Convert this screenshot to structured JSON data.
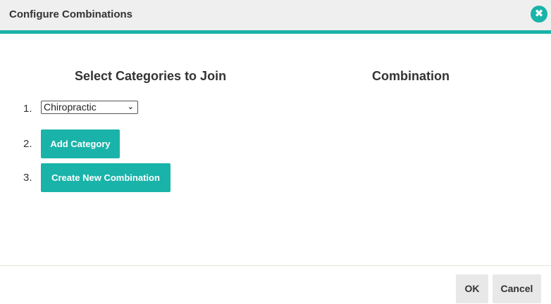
{
  "dialog": {
    "title": "Configure Combinations",
    "close_icon": "close-icon",
    "close_glyph": "✖"
  },
  "left_column": {
    "heading": "Select Categories to Join",
    "steps": [
      {
        "number": "1.",
        "select_value": "Chiropractic"
      },
      {
        "number": "2.",
        "button_label": "Add Category"
      },
      {
        "number": "3.",
        "button_label": "Create New Combination"
      }
    ]
  },
  "right_column": {
    "heading": "Combination"
  },
  "footer": {
    "ok_label": "OK",
    "cancel_label": "Cancel"
  },
  "colors": {
    "accent": "#1ab3a9",
    "header_bg": "#efefef",
    "footer_button_bg": "#e8e8e8"
  }
}
